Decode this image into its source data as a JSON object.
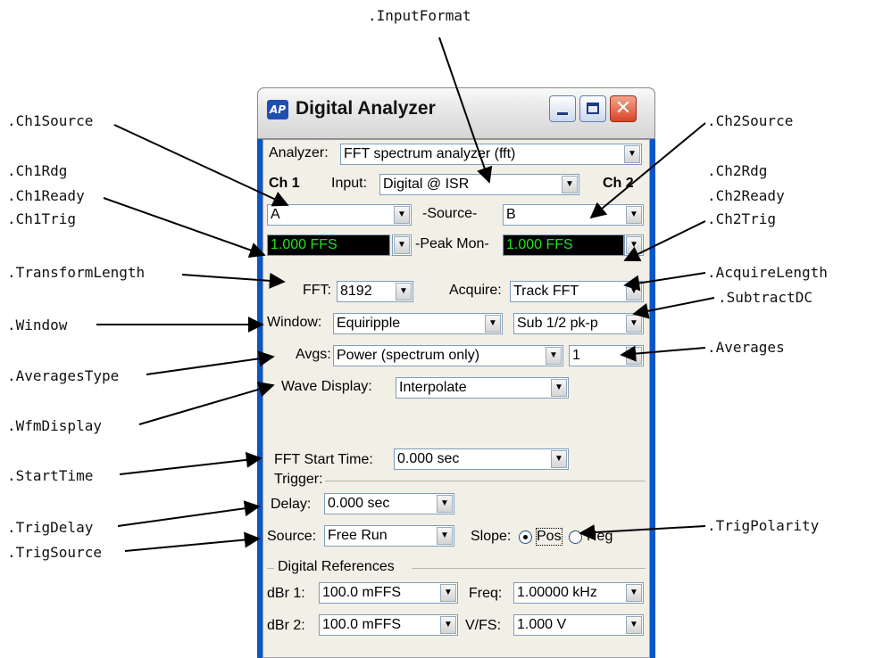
{
  "annotations": {
    "input_format": ".InputFormat",
    "ch1_source": ".Ch1Source",
    "ch1_rdg": ".Ch1Rdg",
    "ch1_ready": ".Ch1Ready",
    "ch1_trig": ".Ch1Trig",
    "transform_length": ".TransformLength",
    "window": ".Window",
    "averages_type": ".AveragesType",
    "wfm_display": ".WfmDisplay",
    "start_time": ".StartTime",
    "trig_delay": ".TrigDelay",
    "trig_source": ".TrigSource",
    "ch2_source": ".Ch2Source",
    "ch2_rdg": ".Ch2Rdg",
    "ch2_ready": ".Ch2Ready",
    "ch2_trig": ".Ch2Trig",
    "acquire_length": ".AcquireLength",
    "subtract_dc": ".SubtractDC",
    "averages": ".Averages",
    "trig_polarity": ".TrigPolarity"
  },
  "window": {
    "icon_text": "AP",
    "title": "Digital Analyzer",
    "close_glyph": "✕"
  },
  "analyzer": {
    "label": "Analyzer:",
    "value": "FFT spectrum analyzer (fft)"
  },
  "channels": {
    "ch1": "Ch 1",
    "ch2": "Ch 2",
    "input_label": "Input:",
    "input_value": "Digital @ ISR"
  },
  "source": {
    "label": "-Source-",
    "ch1": "A",
    "ch2": "B"
  },
  "peak_mon": {
    "label": "-Peak Mon-",
    "ch1": "1.000   FFS",
    "ch2": "1.000   FFS"
  },
  "fft": {
    "label": "FFT:",
    "value": "8192",
    "acquire_label": "Acquire:",
    "acquire_value": "Track FFT"
  },
  "window_fn": {
    "label": "Window:",
    "value": "Equiripple",
    "subtract_dc": "Sub 1/2 pk-p"
  },
  "averages": {
    "label": "Avgs:",
    "type_value": "Power (spectrum only)",
    "count": "1"
  },
  "wave_display": {
    "label": "Wave Display:",
    "value": "Interpolate"
  },
  "start_time": {
    "label": "FFT Start Time:",
    "value": "0.000   sec"
  },
  "trigger": {
    "group_label": "Trigger:",
    "delay_label": "Delay:",
    "delay_value": "0.000   sec",
    "source_label": "Source:",
    "source_value": "Free Run",
    "slope_label": "Slope:",
    "pos": "Pos",
    "neg": "Neg"
  },
  "references": {
    "group_label": "Digital References",
    "dbr1_label": "dBr 1:",
    "dbr1_value": "100.0   mFFS",
    "dbr2_label": "dBr 2:",
    "dbr2_value": "100.0   mFFS",
    "freq_label": "Freq:",
    "freq_value": "1.00000 kHz",
    "vfs_label": "V/FS:",
    "vfs_value": "1.000   V"
  },
  "dropdown_glyph": "▼"
}
